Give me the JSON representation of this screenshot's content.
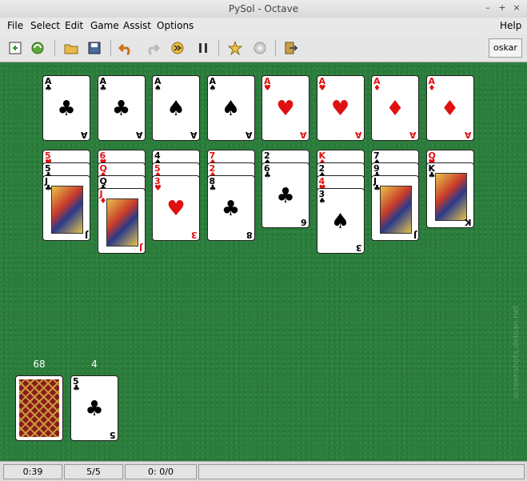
{
  "window": {
    "title": "PySol - Octave",
    "btn_min": "–",
    "btn_max": "+",
    "btn_close": "×"
  },
  "menu": {
    "file": "File",
    "select": "Select",
    "edit": "Edit",
    "game": "Game",
    "assist": "Assist",
    "options": "Options",
    "help": "Help"
  },
  "toolbar": {
    "player": "oskar"
  },
  "foundations": [
    {
      "rank": "A",
      "suit": "♣",
      "color": "blk"
    },
    {
      "rank": "A",
      "suit": "♣",
      "color": "blk"
    },
    {
      "rank": "A",
      "suit": "♠",
      "color": "blk"
    },
    {
      "rank": "A",
      "suit": "♠",
      "color": "blk"
    },
    {
      "rank": "A",
      "suit": "♥",
      "color": "red"
    },
    {
      "rank": "A",
      "suit": "♥",
      "color": "red"
    },
    {
      "rank": "A",
      "suit": "♦",
      "color": "red"
    },
    {
      "rank": "A",
      "suit": "♦",
      "color": "red"
    }
  ],
  "tableau": [
    {
      "cards": [
        {
          "rank": "5",
          "suit": "♥",
          "color": "red"
        },
        {
          "rank": "5",
          "suit": "♣",
          "color": "blk"
        },
        {
          "rank": "J",
          "suit": "♣",
          "color": "blk",
          "face": true
        }
      ]
    },
    {
      "cards": [
        {
          "rank": "6",
          "suit": "♥",
          "color": "red"
        },
        {
          "rank": "Q",
          "suit": "♦",
          "color": "red"
        },
        {
          "rank": "Q",
          "suit": "♣",
          "color": "blk"
        },
        {
          "rank": "J",
          "suit": "♦",
          "color": "red",
          "face": true
        }
      ]
    },
    {
      "cards": [
        {
          "rank": "4",
          "suit": "♠",
          "color": "blk"
        },
        {
          "rank": "5",
          "suit": "♦",
          "color": "red"
        },
        {
          "rank": "3",
          "suit": "♥",
          "color": "red"
        }
      ]
    },
    {
      "cards": [
        {
          "rank": "7",
          "suit": "♦",
          "color": "red"
        },
        {
          "rank": "2",
          "suit": "♦",
          "color": "red"
        },
        {
          "rank": "8",
          "suit": "♣",
          "color": "blk"
        }
      ]
    },
    {
      "cards": [
        {
          "rank": "2",
          "suit": "♠",
          "color": "blk"
        },
        {
          "rank": "6",
          "suit": "♣",
          "color": "blk"
        }
      ]
    },
    {
      "cards": [
        {
          "rank": "K",
          "suit": "♦",
          "color": "red"
        },
        {
          "rank": "2",
          "suit": "♠",
          "color": "blk"
        },
        {
          "rank": "4",
          "suit": "♥",
          "color": "red"
        },
        {
          "rank": "3",
          "suit": "♠",
          "color": "blk"
        }
      ]
    },
    {
      "cards": [
        {
          "rank": "7",
          "suit": "♠",
          "color": "blk"
        },
        {
          "rank": "9",
          "suit": "♣",
          "color": "blk"
        },
        {
          "rank": "J",
          "suit": "♣",
          "color": "blk",
          "face": true
        }
      ]
    },
    {
      "cards": [
        {
          "rank": "Q",
          "suit": "♥",
          "color": "red"
        },
        {
          "rank": "K",
          "suit": "♣",
          "color": "blk",
          "face": true
        }
      ]
    }
  ],
  "stock": {
    "count": "68"
  },
  "waste": {
    "count": "4",
    "rank": "5",
    "suit": "♣",
    "color": "blk"
  },
  "status": {
    "time": "0:39",
    "moves": "5/5",
    "score": "0: 0/0"
  },
  "watermark": "screenshots.debian.net"
}
